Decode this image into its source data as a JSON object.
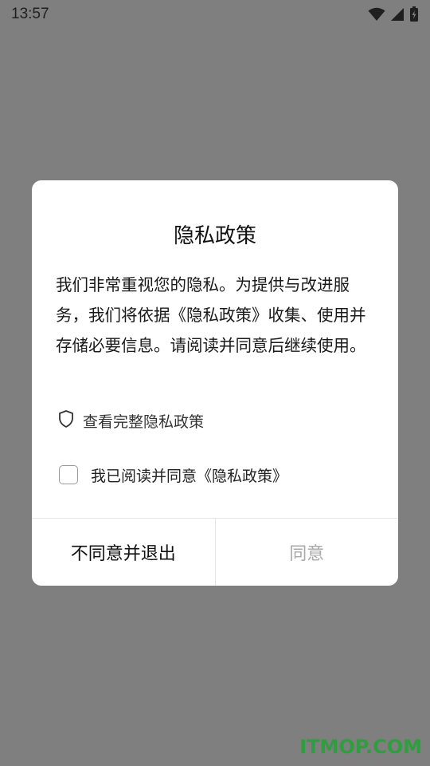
{
  "status_bar": {
    "time": "13:57",
    "icons": [
      "wifi-icon",
      "cell-signal-icon",
      "battery-charging-icon"
    ]
  },
  "dialog": {
    "title": "隐私政策",
    "body": "我们非常重视您的隐私。为提供与改进服务，我们将依据《隐私政策》收集、使用并存储必要信息。请阅读并同意后继续使用。",
    "policy_link": {
      "icon": "shield-icon",
      "label": "查看完整隐私政策"
    },
    "consent": {
      "checked": false,
      "label": "我已阅读并同意《隐私政策》"
    },
    "buttons": {
      "disagree": "不同意并退出",
      "agree": "同意"
    }
  },
  "watermark": "ITMOP.COM",
  "colors": {
    "overlay": "#7f7f7f",
    "dialog_bg": "#ffffff",
    "agree_disabled": "#a9a9a9",
    "watermark": "#2f9e3e"
  }
}
